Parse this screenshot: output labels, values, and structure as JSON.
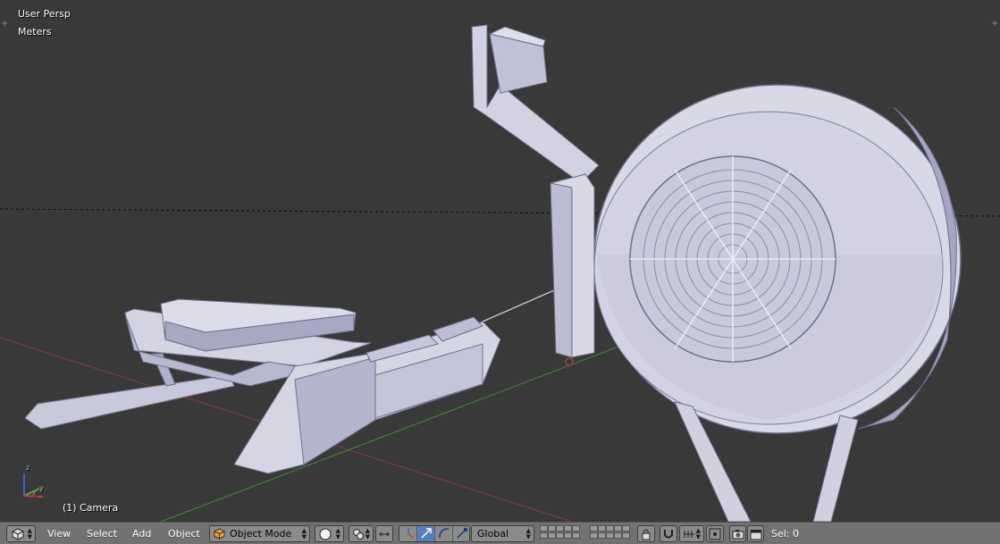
{
  "viewport": {
    "view_name": "User Persp",
    "units": "Meters",
    "active_object": "(1) Camera",
    "axis_labels": {
      "z": "z",
      "y": "y",
      "x": "x"
    }
  },
  "header": {
    "editor_type_icon": "cube-icon",
    "menus": {
      "view": "View",
      "select": "Select",
      "add": "Add",
      "object": "Object"
    },
    "mode": {
      "label": "Object Mode",
      "icon": "object-mode-cube-icon"
    },
    "shading_icon": "solid-sphere-icon",
    "pivot_icon": "pivot-point-icon",
    "manipulator_icons": [
      "translate-arrow-icon",
      "rotate-arc-icon",
      "scale-icon"
    ],
    "orientation": "Global",
    "snap_icon": "magnet-icon",
    "status": "Sel: 0"
  },
  "colors": {
    "viewport_bg": "#393939",
    "header_bg": "#727272",
    "mesh_light": "#d8d8e6",
    "mesh_shadow": "#a4a4c2",
    "active_button": "#5680c2",
    "x_axis": "#b94a4a",
    "y_axis": "#5fa84b"
  }
}
